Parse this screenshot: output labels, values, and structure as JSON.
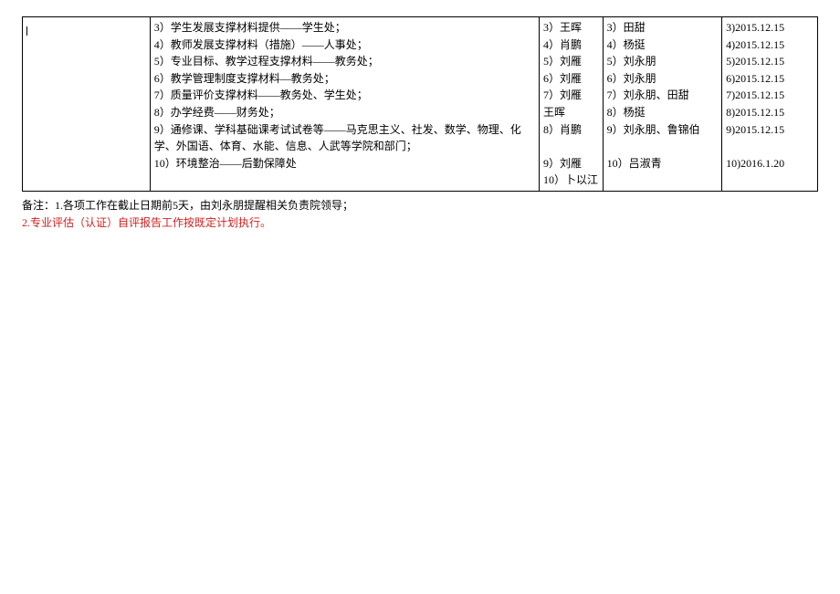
{
  "table": {
    "tasks": [
      "3）学生发展支撑材料提供――学生处；",
      "4）教师发展支撑材料（措施）――人事处；",
      "5）专业目标、教学过程支撑材料――教务处；",
      "6）教学管理制度支撑材料―教务处；",
      "7）质量评价支撑材料――教务处、学生处；",
      "8）办学经费――财务处；",
      "9）通修课、学科基础课考试试卷等――马克思主义、社发、数学、物理、化学、外国语、体育、水能、信息、人武等学院和部门；",
      "10）环境整治――后勤保障处"
    ],
    "col_a": [
      "3）王晖",
      "4）肖鹏",
      "5）刘雁",
      "6）刘雁",
      "7）刘雁",
      "王晖",
      "8）肖鹏",
      "",
      "9）刘雁",
      "10）卜以江"
    ],
    "col_b": [
      "3）田甜",
      "4）杨挺",
      "5）刘永朋",
      "6）刘永朋",
      "7）刘永朋、田甜",
      "8）杨挺",
      "9）刘永朋、鲁锦伯",
      "",
      "10）吕淑青",
      ""
    ],
    "col_c": [
      "3)2015.12.15",
      "4)2015.12.15",
      "5)2015.12.15",
      "6)2015.12.15",
      "7)2015.12.15",
      "8)2015.12.15",
      "9)2015.12.15",
      "",
      "10)2016.1.20",
      ""
    ]
  },
  "notes": {
    "line1": "备注：1.各项工作在截止日期前5天，由刘永朋提醒相关负责院领导；",
    "line2": "2.专业评估（认证）自评报告工作按既定计划执行。"
  }
}
